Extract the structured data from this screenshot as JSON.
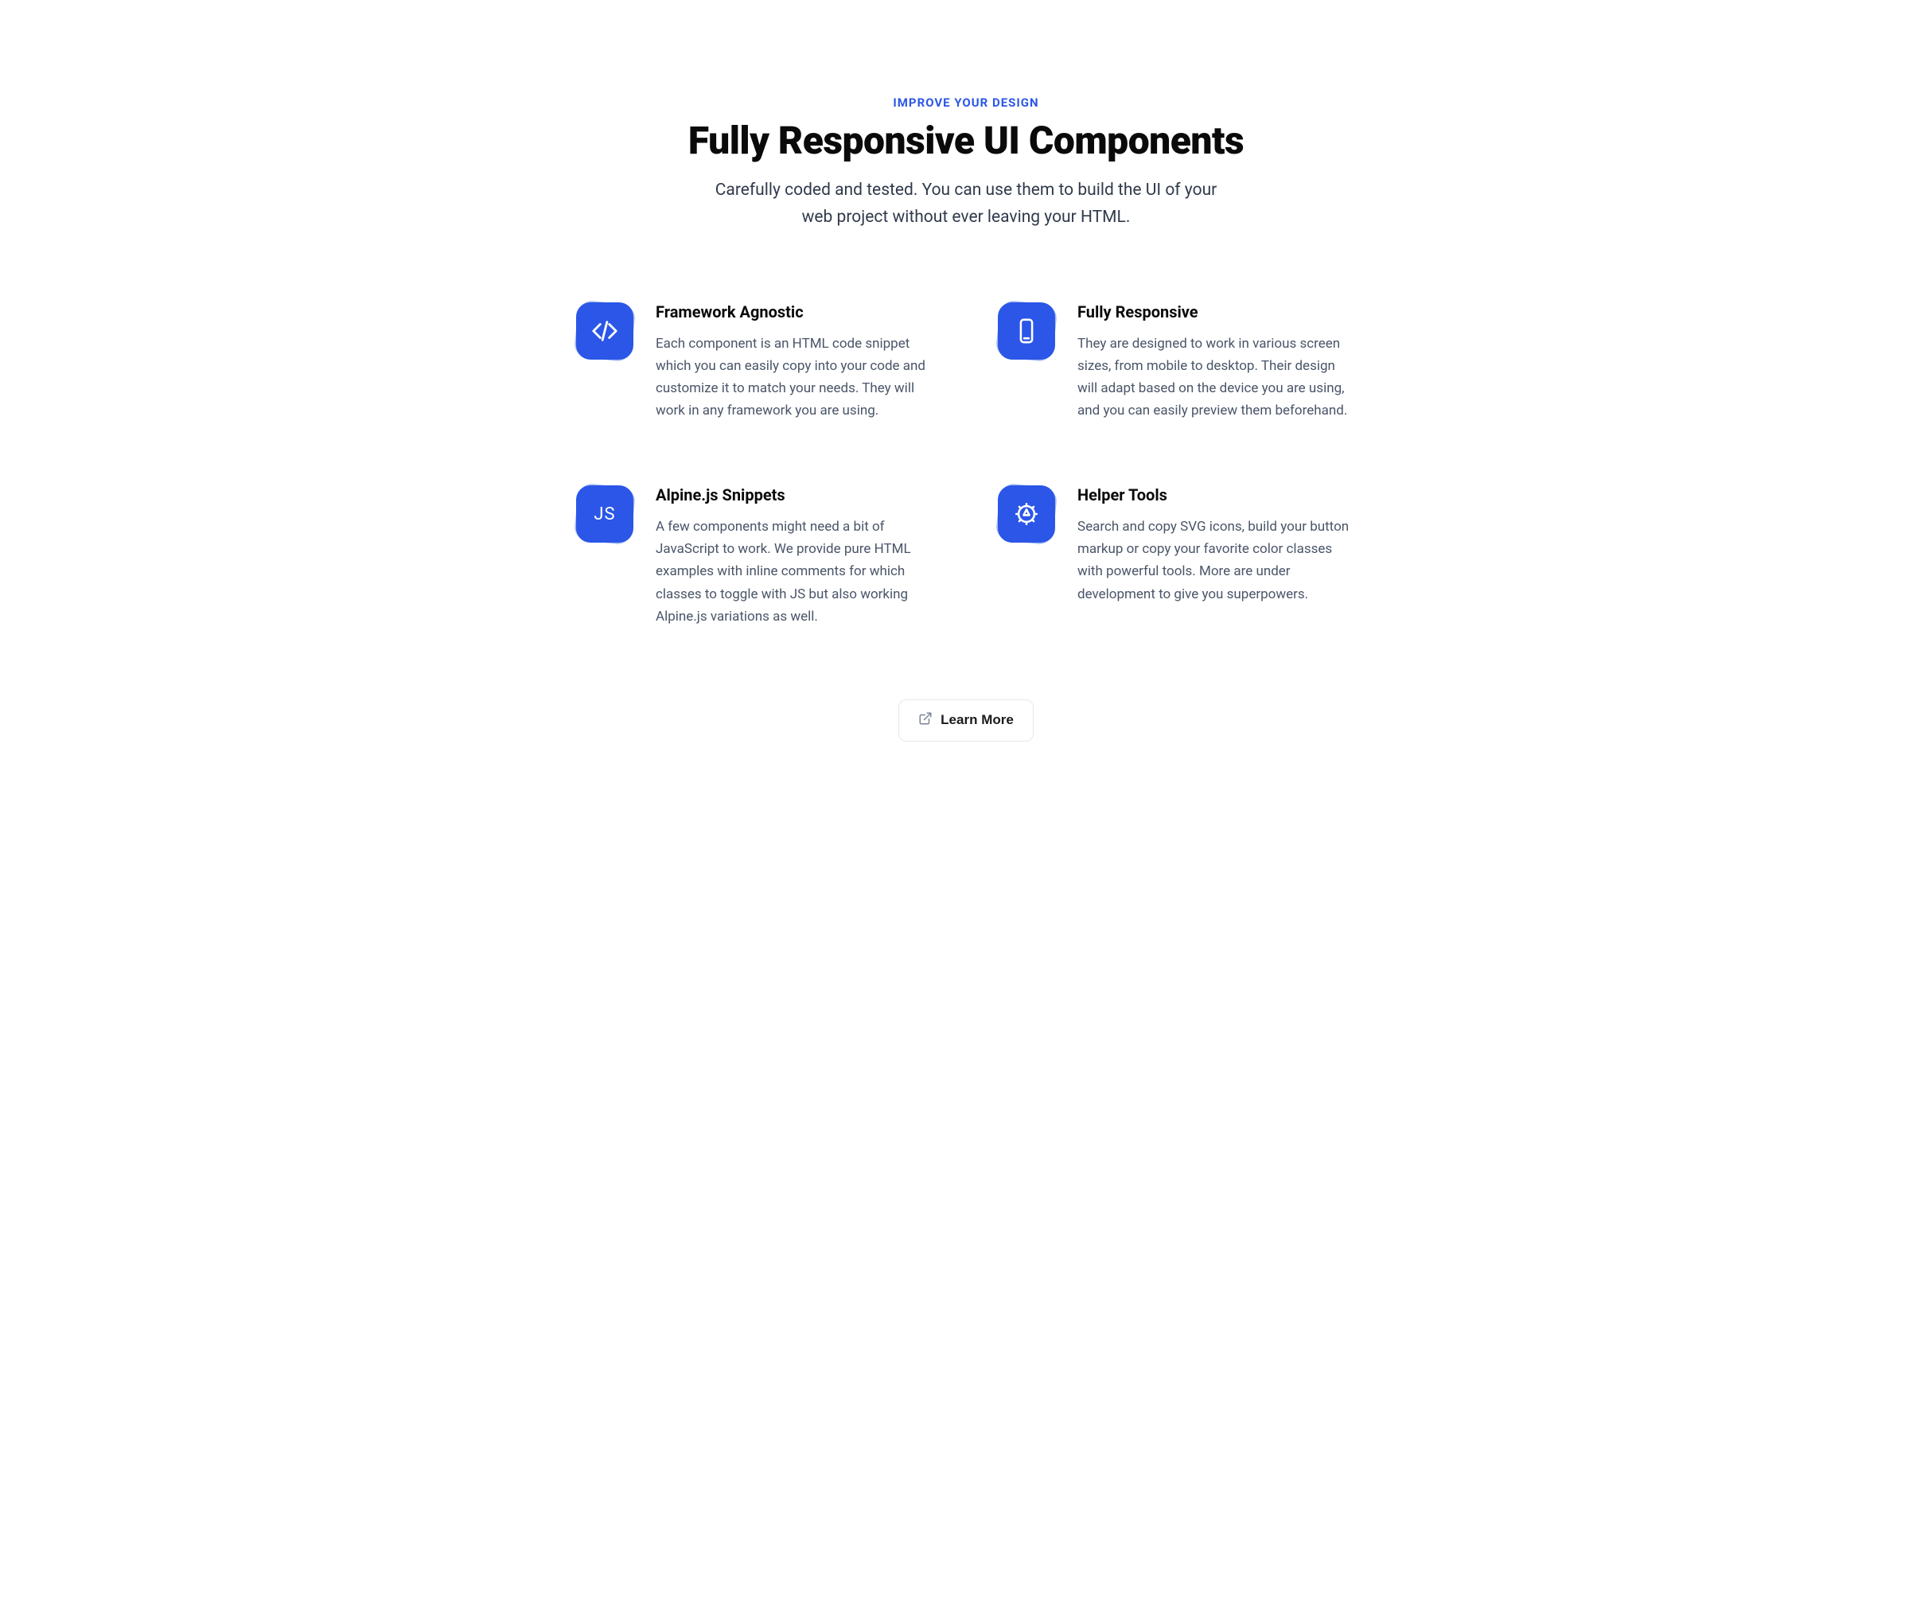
{
  "header": {
    "eyebrow": "IMPROVE YOUR DESIGN",
    "title": "Fully Responsive UI Components",
    "subtitle": "Carefully coded and tested. You can use them to build the UI of your web project without ever leaving your HTML."
  },
  "features": [
    {
      "icon": "code-icon",
      "title": "Framework Agnostic",
      "description": "Each component is an HTML code snippet which you can easily copy into your code and customize it to match your needs. They will work in any framework you are using."
    },
    {
      "icon": "smartphone-icon",
      "title": "Fully Responsive",
      "description": "They are designed to work in various screen sizes, from mobile to desktop. Their design will adapt based on the device you are using, and you can easily preview them beforehand."
    },
    {
      "icon": "js-icon",
      "js_text": "JS",
      "title": "Alpine.js Snippets",
      "description": "A few components might need a bit of JavaScript to work. We provide pure HTML examples with inline comments for which classes to toggle with JS but also working Alpine.js variations as well."
    },
    {
      "icon": "gear-icon",
      "title": "Helper Tools",
      "description": "Search and copy SVG icons, build your button markup or copy your favorite color classes with powerful tools. More are under development to give you superpowers."
    }
  ],
  "cta": {
    "label": "Learn More"
  },
  "colors": {
    "accent": "#2b56e7",
    "accent_light": "#a8bdf4",
    "text_primary": "#0a0a0a",
    "text_body": "#4a5568"
  }
}
